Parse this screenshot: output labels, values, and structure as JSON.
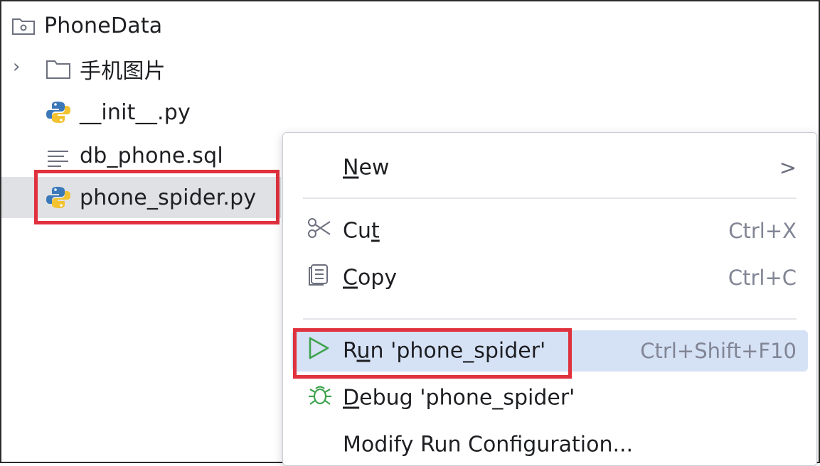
{
  "project_tree": {
    "root": {
      "label": "PhoneData",
      "icon": "module-folder-icon"
    },
    "items": [
      {
        "label": "手机图片",
        "icon": "folder-icon",
        "expandable": true
      },
      {
        "label": "__init__.py",
        "icon": "python-file-icon"
      },
      {
        "label": "db_phone.sql",
        "icon": "text-file-icon"
      },
      {
        "label": "phone_spider.py",
        "icon": "python-file-icon",
        "selected": true
      }
    ]
  },
  "context_menu": {
    "new": {
      "mnemonic": "N",
      "rest": "ew",
      "submenu_glyph": ">"
    },
    "cut": {
      "pre": "Cu",
      "mnemonic": "t",
      "shortcut": "Ctrl+X",
      "icon": "scissors-icon"
    },
    "copy": {
      "mnemonic": "C",
      "rest": "opy",
      "shortcut": "Ctrl+C",
      "icon": "copy-icon"
    },
    "run": {
      "pre": "R",
      "mnemonic": "u",
      "rest": "n 'phone_spider'",
      "shortcut": "Ctrl+Shift+F10",
      "icon": "run-icon"
    },
    "debug": {
      "mnemonic": "D",
      "rest": "ebug 'phone_spider'",
      "icon": "debug-icon"
    },
    "modify": {
      "label": "Modify Run Configuration..."
    }
  },
  "colors": {
    "highlight_border": "#e0313e",
    "active_item_bg": "#d5e1f5",
    "run_icon": "#3fa34d",
    "python_blue": "#3b78b8",
    "python_yellow": "#f2c230"
  }
}
